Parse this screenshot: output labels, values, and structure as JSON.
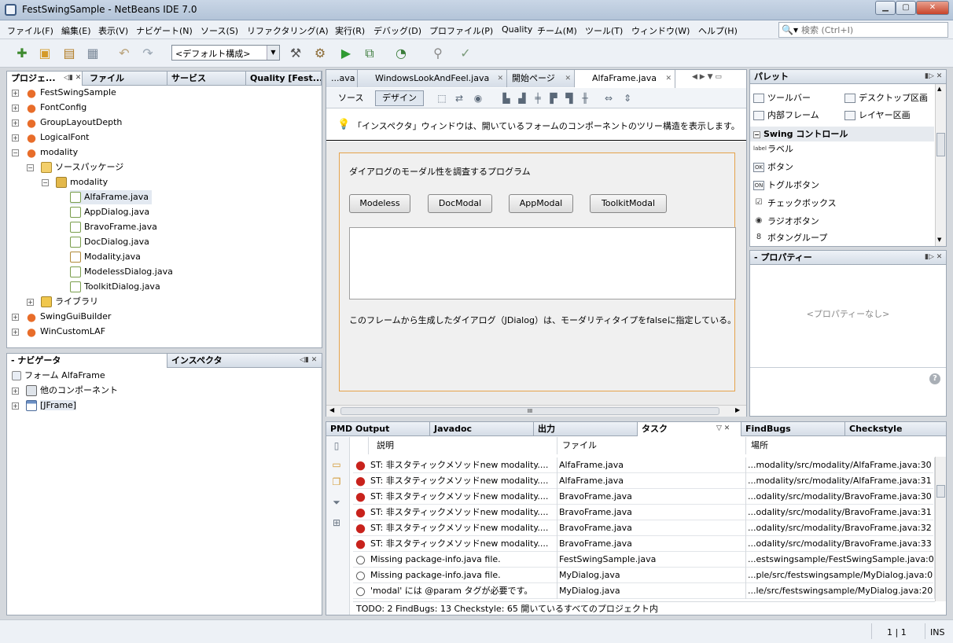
{
  "window": {
    "title": "FestSwingSample - NetBeans IDE 7.0"
  },
  "menu": [
    "ファイル(F)",
    "編集(E)",
    "表示(V)",
    "ナビゲート(N)",
    "ソース(S)",
    "リファクタリング(A)",
    "実行(R)",
    "デバッグ(D)",
    "プロファイル(P)",
    "Quality",
    "チーム(M)",
    "ツール(T)",
    "ウィンドウ(W)",
    "ヘルプ(H)"
  ],
  "search": {
    "placeholder": "検索 (Ctrl+I)"
  },
  "toolbar": {
    "config": "<デフォルト構成>"
  },
  "projects": {
    "tabs": [
      "プロジェ...",
      "ファイル",
      "サービス",
      "Quality [Fest..."
    ],
    "items": [
      {
        "label": "FestSwingSample"
      },
      {
        "label": "FontConfig"
      },
      {
        "label": "GroupLayoutDepth"
      },
      {
        "label": "LogicalFont"
      },
      {
        "label": "modality"
      },
      {
        "label": "ソースパッケージ"
      },
      {
        "label": "modality"
      },
      {
        "label": "AlfaFrame.java"
      },
      {
        "label": "AppDialog.java"
      },
      {
        "label": "BravoFrame.java"
      },
      {
        "label": "DocDialog.java"
      },
      {
        "label": "Modality.java"
      },
      {
        "label": "ModelessDialog.java"
      },
      {
        "label": "ToolkitDialog.java"
      },
      {
        "label": "ライブラリ"
      },
      {
        "label": "SwingGuiBuilder"
      },
      {
        "label": "WinCustomLAF"
      }
    ]
  },
  "navigator": {
    "tabs": [
      "- ナビゲータ",
      "インスペクタ"
    ],
    "items": [
      "フォーム AlfaFrame",
      "他のコンポーネント",
      "[JFrame]"
    ]
  },
  "editor": {
    "tabs": [
      "...ava",
      "WindowsLookAndFeel.java",
      "開始ページ",
      "AlfaFrame.java"
    ],
    "mode_source": "ソース",
    "mode_design": "デザイン",
    "hint": "「インスペクタ」ウィンドウは、開いているフォームのコンポーネントのツリー構造を表示します。",
    "form": {
      "heading": "ダイアログのモーダル性を調査するプログラム",
      "buttons": [
        "Modeless",
        "DocModal",
        "AppModal",
        "ToolkitModal"
      ],
      "footer": "このフレームから生成したダイアログ（JDialog）は、モーダリティタイプをfalseに指定している。"
    },
    "scroll_label": "III"
  },
  "palette": {
    "title": "パレット",
    "top_items": [
      [
        "ツールバー",
        "デスクトップ区画"
      ],
      [
        "内部フレーム",
        "レイヤー区画"
      ]
    ],
    "section": "Swing コントロール",
    "items": [
      {
        "icon": "label",
        "label": "ラベル"
      },
      {
        "icon": "OK",
        "label": "ボタン"
      },
      {
        "icon": "ON",
        "label": "トグルボタン"
      },
      {
        "icon": "☑",
        "label": "チェックボックス"
      },
      {
        "icon": "◉",
        "label": "ラジオボタン"
      },
      {
        "icon": "8",
        "label": "ボタングループ"
      }
    ]
  },
  "properties": {
    "title": "- プロパティー",
    "empty": "<プロパティーなし>"
  },
  "output": {
    "tabs": [
      "PMD Output",
      "Javadoc",
      "出力",
      "タスク",
      "FindBugs",
      "Checkstyle"
    ],
    "columns": [
      "説明",
      "ファイル",
      "場所"
    ],
    "rows": [
      {
        "type": "bug",
        "desc": "ST: 非スタティックメソッドnew modality....",
        "file": "AlfaFrame.java",
        "loc": "...modality/src/modality/AlfaFrame.java:30"
      },
      {
        "type": "bug",
        "desc": "ST: 非スタティックメソッドnew modality....",
        "file": "AlfaFrame.java",
        "loc": "...modality/src/modality/AlfaFrame.java:31"
      },
      {
        "type": "bug",
        "desc": "ST: 非スタティックメソッドnew modality....",
        "file": "BravoFrame.java",
        "loc": "...odality/src/modality/BravoFrame.java:30"
      },
      {
        "type": "bug",
        "desc": "ST: 非スタティックメソッドnew modality....",
        "file": "BravoFrame.java",
        "loc": "...odality/src/modality/BravoFrame.java:31"
      },
      {
        "type": "bug",
        "desc": "ST: 非スタティックメソッドnew modality....",
        "file": "BravoFrame.java",
        "loc": "...odality/src/modality/BravoFrame.java:32"
      },
      {
        "type": "bug",
        "desc": "ST: 非スタティックメソッドnew modality....",
        "file": "BravoFrame.java",
        "loc": "...odality/src/modality/BravoFrame.java:33"
      },
      {
        "type": "style",
        "desc": "Missing package-info.java file.",
        "file": "FestSwingSample.java",
        "loc": "...estswingsample/FestSwingSample.java:0"
      },
      {
        "type": "style",
        "desc": "Missing package-info.java file.",
        "file": "MyDialog.java",
        "loc": "...ple/src/festswingsample/MyDialog.java:0"
      },
      {
        "type": "style",
        "desc": "'modal' には @param タグが必要です。",
        "file": "MyDialog.java",
        "loc": "...le/src/festswingsample/MyDialog.java:20"
      }
    ],
    "summary": "TODO: 2  FindBugs: 13  Checkstyle: 65 開いているすべてのプロジェクト内"
  },
  "status": {
    "position": "1 | 1",
    "mode": "INS"
  },
  "colors": {
    "accent": "#e5a24a",
    "bug": "#c8221c",
    "selection": "#e3e9f1"
  }
}
